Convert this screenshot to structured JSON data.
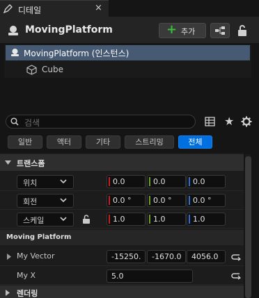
{
  "tab": {
    "label": "디테일",
    "close": "×"
  },
  "header": {
    "title": "MovingPlatform",
    "add_label": "추가",
    "add_plus": "+"
  },
  "tree": {
    "root": "MovingPlatform (인스턴스)",
    "child": "Cube"
  },
  "search": {
    "placeholder": "검색"
  },
  "filters": [
    "일반",
    "액터",
    "기타",
    "스트리밍",
    "전체"
  ],
  "active_filter": "전체",
  "transform": {
    "category": "트랜스폼",
    "location": {
      "label": "위치",
      "x": "0.0",
      "y": "0.0",
      "z": "0.0"
    },
    "rotation": {
      "label": "회전",
      "x": "0.0 °",
      "y": "0.0 °",
      "z": "0.0 °"
    },
    "scale": {
      "label": "스케일",
      "x": "1.0",
      "y": "1.0",
      "z": "1.0"
    }
  },
  "moving_platform": {
    "category": "Moving Platform",
    "my_vector": {
      "label": "My Vector",
      "x": "-15250.",
      "y": "-1670.0",
      "z": "4056.0"
    },
    "my_x": {
      "label": "My X",
      "value": "5.0"
    }
  },
  "rendering": {
    "category": "렌더링"
  },
  "colors": {
    "x_axis": "#c52323",
    "y_axis": "#6c9d2a",
    "z_axis": "#2d6fd8",
    "accent": "#0070e0",
    "add_plus": "#3cbc3c"
  }
}
